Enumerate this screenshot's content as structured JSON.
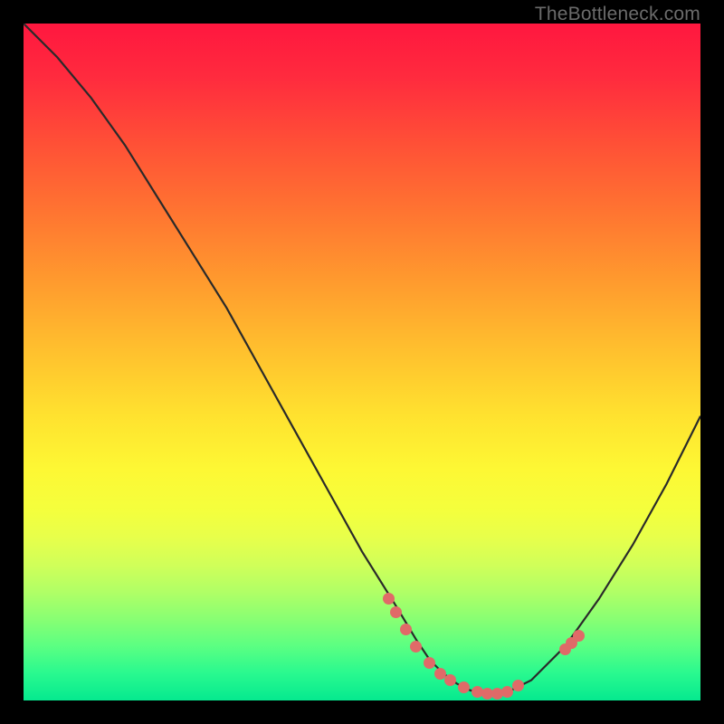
{
  "attribution": "TheBottleneck.com",
  "colors": {
    "frame": "#000000",
    "curve_stroke": "#2a2a2a",
    "dot_fill": "#e06a68"
  },
  "chart_data": {
    "type": "line",
    "title": "",
    "xlabel": "",
    "ylabel": "",
    "xlim": [
      0,
      100
    ],
    "ylim": [
      0,
      100
    ],
    "series": [
      {
        "name": "bottleneck-curve",
        "x": [
          0,
          5,
          10,
          15,
          20,
          25,
          30,
          35,
          40,
          45,
          50,
          55,
          58,
          60,
          62,
          64,
          66,
          68,
          70,
          72,
          75,
          80,
          85,
          90,
          95,
          100
        ],
        "y": [
          100,
          95,
          89,
          82,
          74,
          66,
          58,
          49,
          40,
          31,
          22,
          14,
          9,
          6,
          4,
          2.5,
          1.5,
          1,
          1,
          1.5,
          3,
          8,
          15,
          23,
          32,
          42
        ]
      }
    ],
    "scatter_points": {
      "name": "data-points",
      "x": [
        54,
        55,
        56.5,
        58,
        60,
        61.5,
        63,
        65,
        67,
        68.5,
        70,
        71.5,
        73,
        80,
        81,
        82
      ],
      "y": [
        15,
        13,
        10.5,
        8,
        5.5,
        4,
        3,
        2,
        1.3,
        1,
        1,
        1.3,
        2.2,
        7.5,
        8.5,
        9.5
      ]
    }
  }
}
